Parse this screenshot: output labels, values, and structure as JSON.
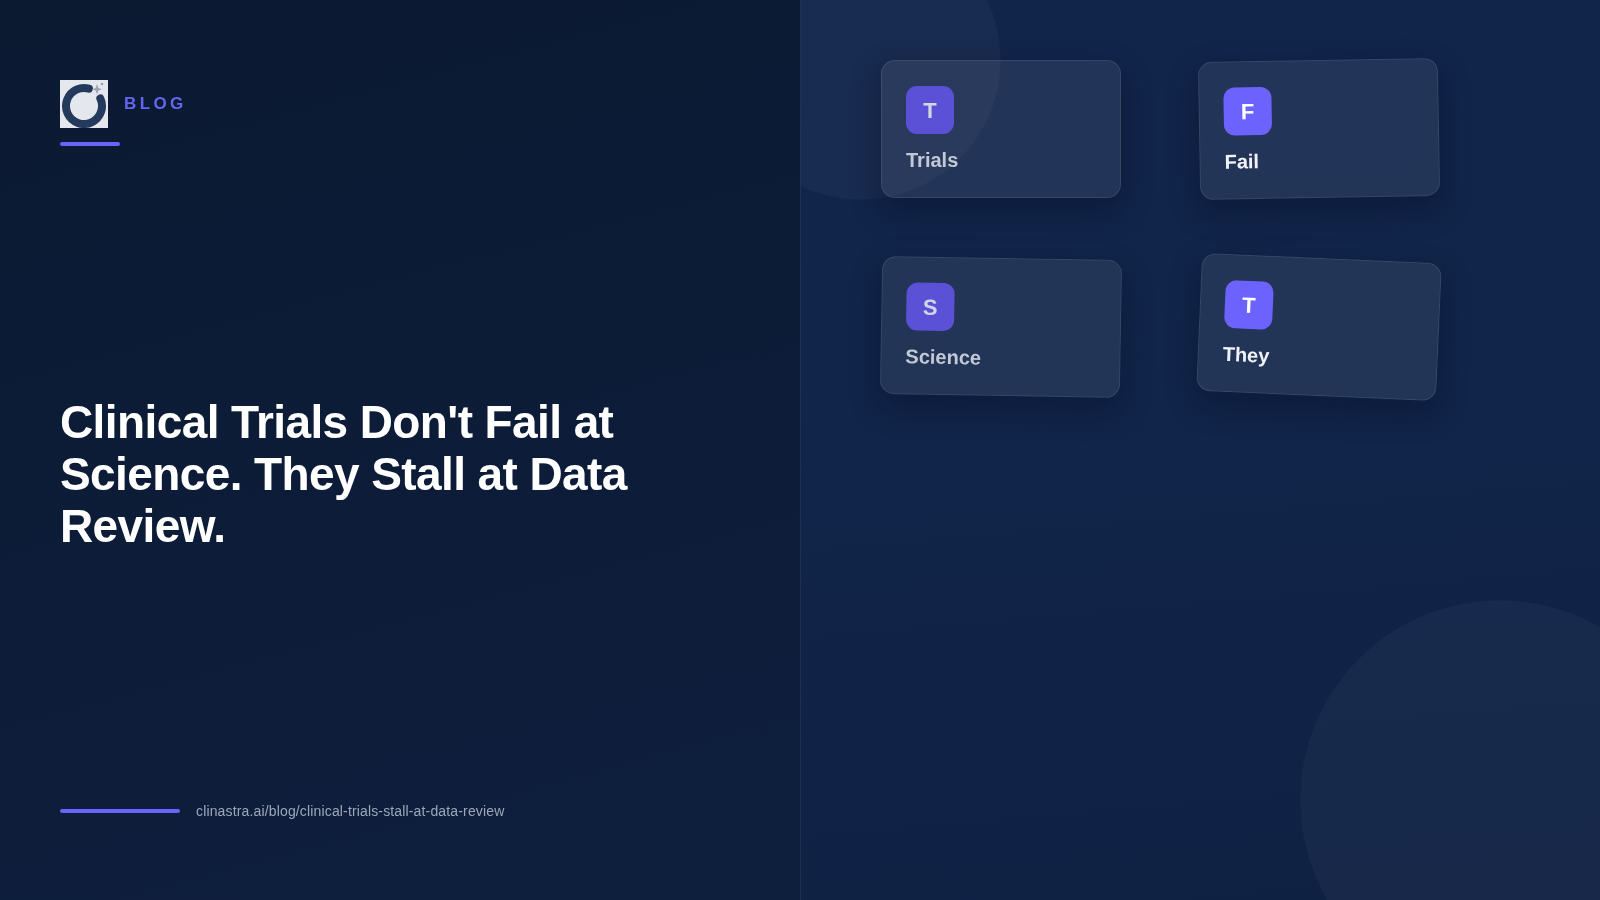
{
  "brand": {
    "label": "BLOG"
  },
  "headline": "Clinical Trials Don't Fail at Science. They Stall at Data Review.",
  "footer": {
    "url": "clinastra.ai/blog/clinical-trials-stall-at-data-review"
  },
  "cards": [
    {
      "letter": "T",
      "label": "Trials",
      "dimmed": true
    },
    {
      "letter": "F",
      "label": "Fail",
      "dimmed": false
    },
    {
      "letter": "S",
      "label": "Science",
      "dimmed": true
    },
    {
      "letter": "T",
      "label": "They",
      "dimmed": false
    }
  ]
}
